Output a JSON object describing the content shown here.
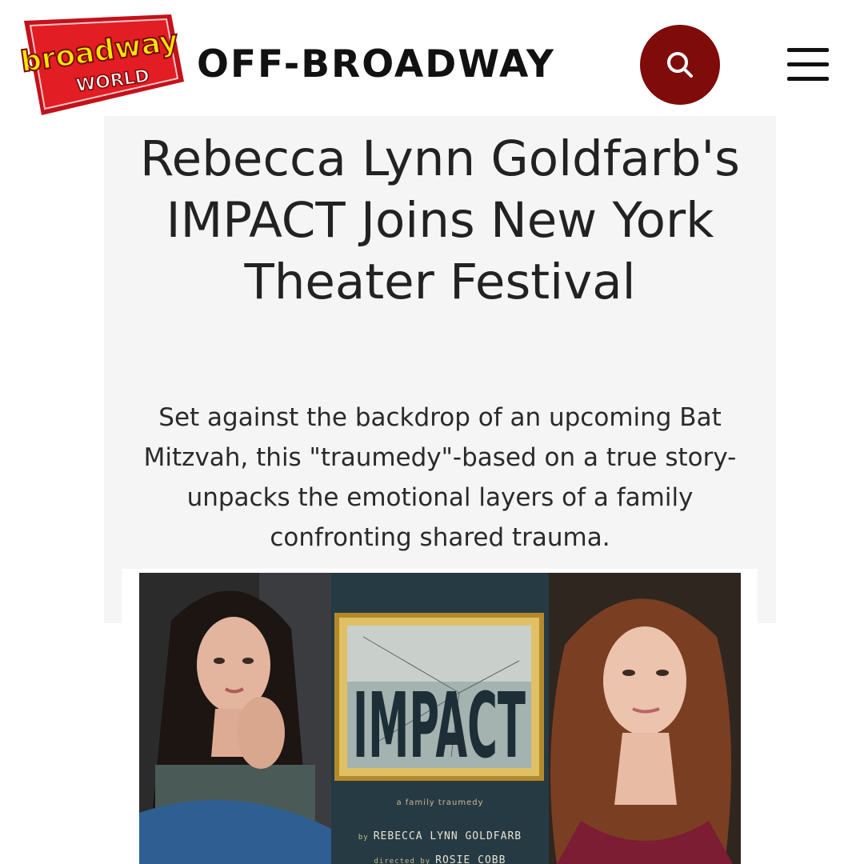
{
  "header": {
    "logo_top": "broadway",
    "logo_bottom": "WORLD",
    "section": "OFF-BROADWAY",
    "search_icon": "search-icon",
    "menu_icon": "hamburger-menu-icon"
  },
  "article": {
    "headline": "Rebecca Lynn Goldfarb's IMPACT Joins New York Theater Festival",
    "subhead": "Set against the backdrop of an upcoming Bat Mitzvah, this \"traumedy\"-based on a true story-unpacks the emotional layers of a family confronting shared trauma."
  },
  "poster": {
    "title": "IMPACT",
    "tagline": "a family traumedy",
    "by_prefix": "by",
    "author": "REBECCA LYNN GOLDFARB",
    "director_prefix": "directed by",
    "director": "ROSIE COBB"
  },
  "colors": {
    "brand_red": "#7f0b0b",
    "logo_red": "#d7161b",
    "logo_yellow": "#f7e600",
    "card_bg": "#f5f5f5"
  }
}
